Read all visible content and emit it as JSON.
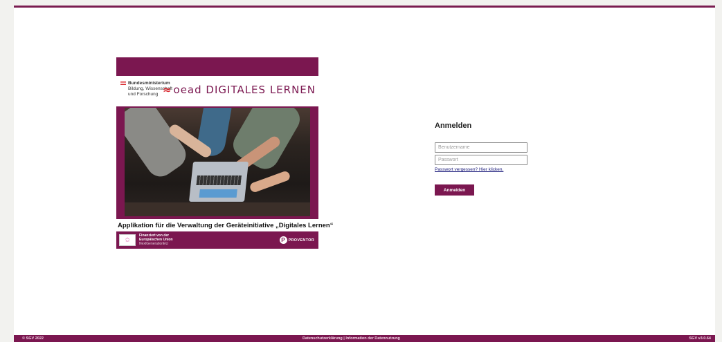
{
  "banner": {
    "ministry": {
      "line1": "Bundesministerium",
      "line2": "Bildung, Wissenschaft",
      "line3": "und Forschung"
    },
    "oead_logo": "oead DIGITALES LERNEN",
    "app_title": "Applikation für die Verwaltung der Geräteinitiative „Digitales Lernen“",
    "eu": {
      "line1": "Finanziert von der",
      "line2": "Europäischen Union",
      "line3": "NextGenerationEU"
    },
    "partner_logo": "PROVENTOR"
  },
  "login": {
    "title": "Anmelden",
    "username_placeholder": "Benutzername",
    "username_value": "",
    "password_placeholder": "Passwort",
    "password_value": "",
    "forgot_link": "Passwort vergessen? Hier klicken.",
    "submit_label": "Anmelden"
  },
  "footer": {
    "copyright": "© SGV 2022",
    "privacy_link": "Datenschutzerklärung",
    "separator": "|",
    "data_usage_link": "Information der Datennutzung",
    "version": "SGV v3.0.64"
  },
  "colors": {
    "brand": "#7b1750",
    "link": "#1a1a7a"
  }
}
